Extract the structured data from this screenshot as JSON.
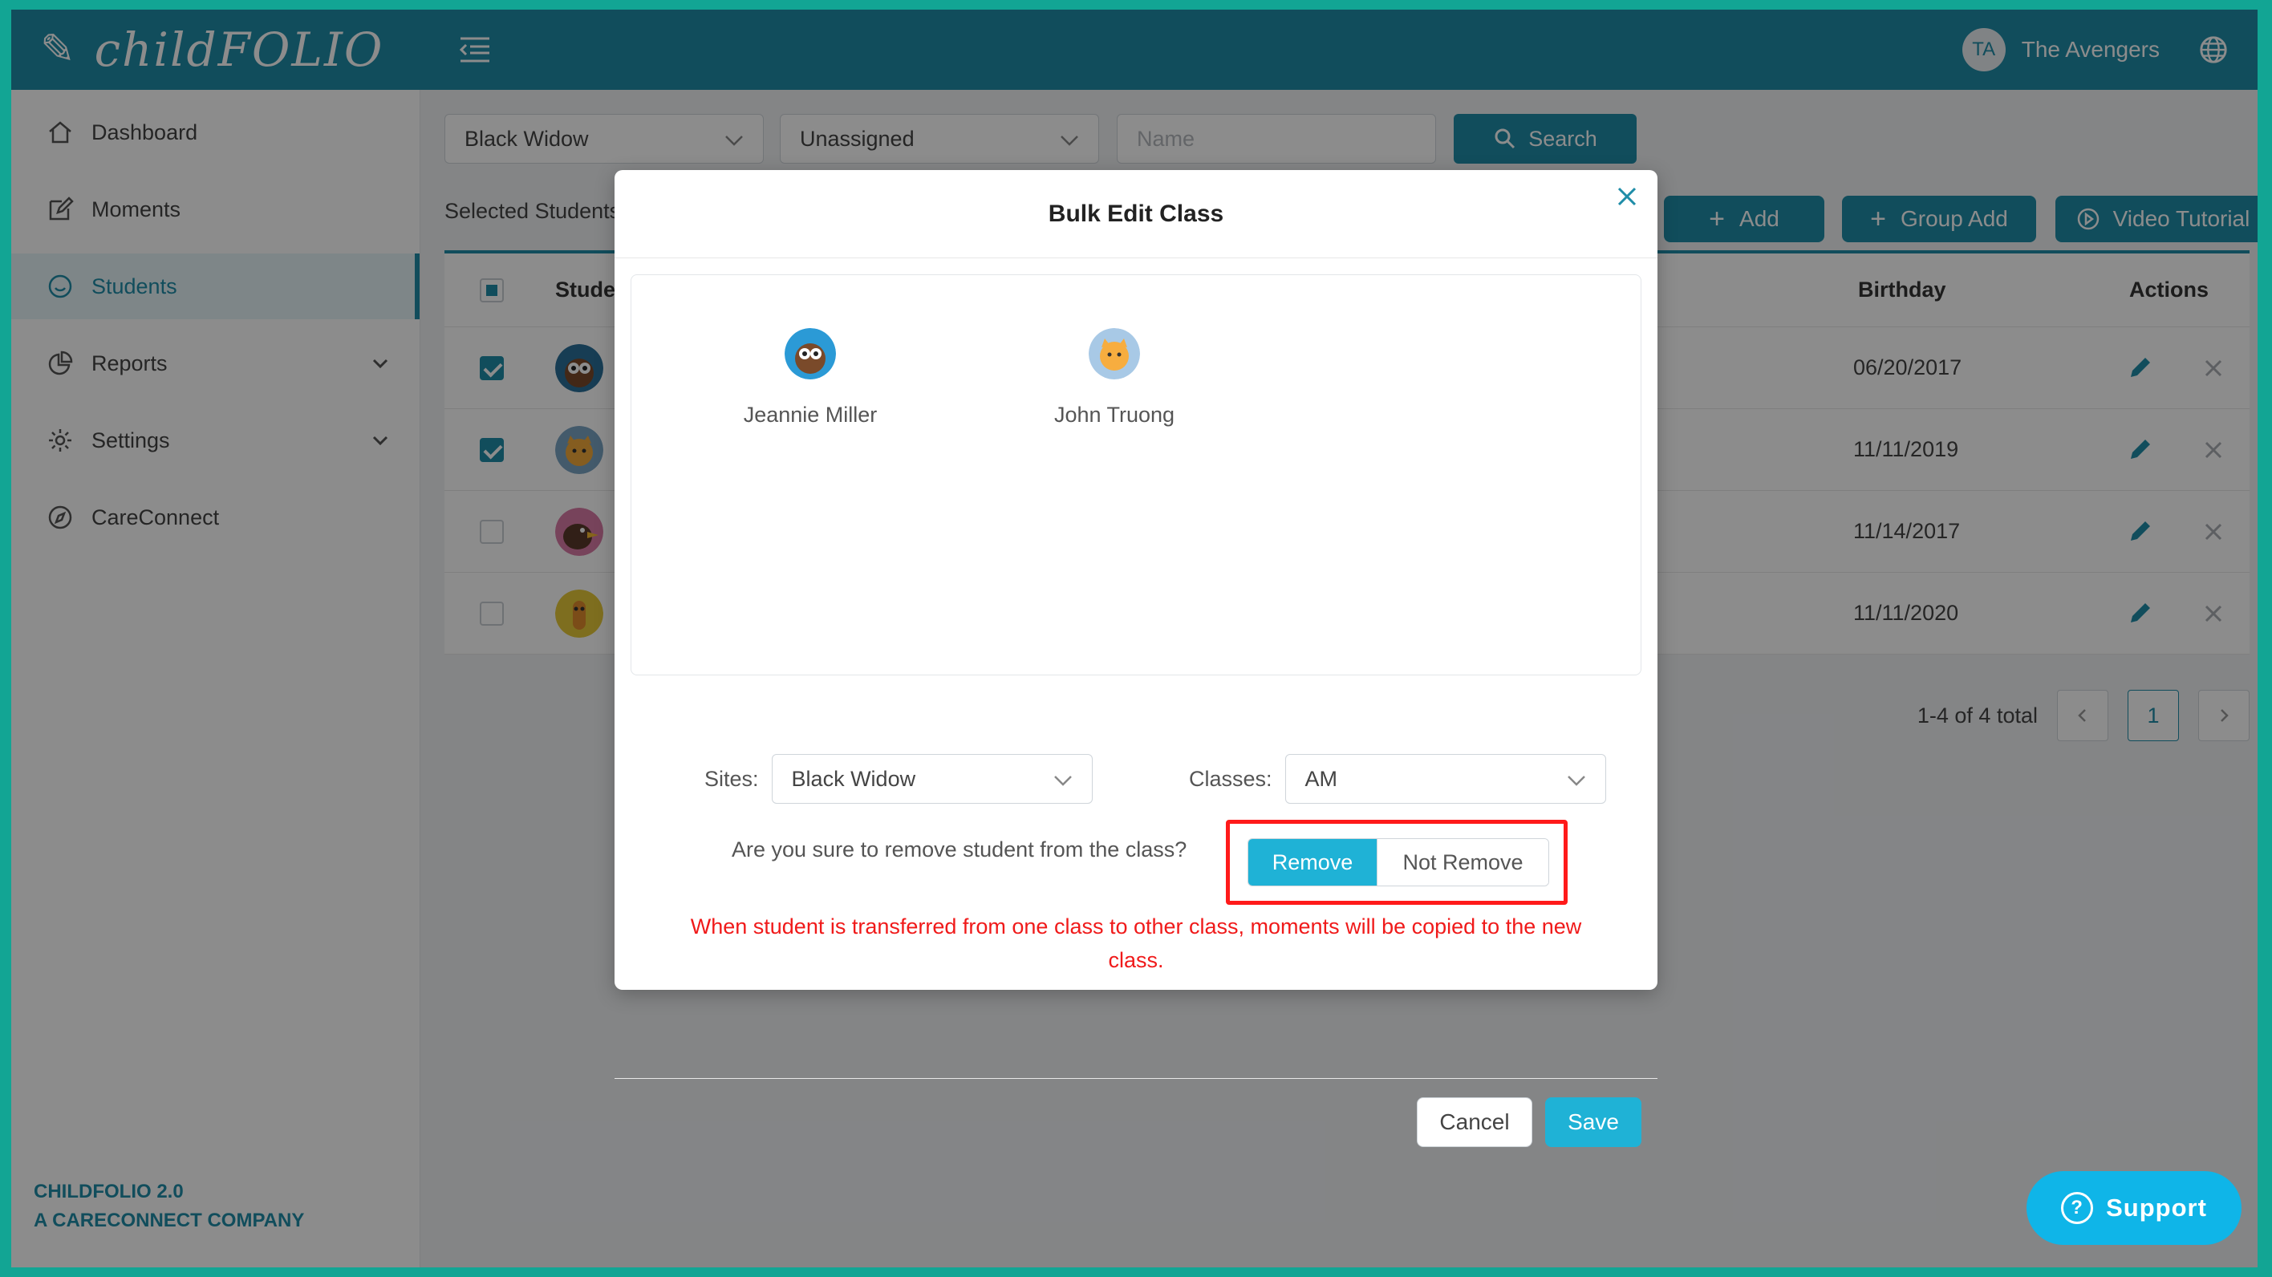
{
  "app": {
    "logo_text": "childFOLIO",
    "user_initials": "TA",
    "user_name": "The Avengers"
  },
  "sidebar": {
    "items": [
      {
        "label": "Dashboard",
        "icon": "home-icon"
      },
      {
        "label": "Moments",
        "icon": "edit-icon"
      },
      {
        "label": "Students",
        "icon": "smile-icon",
        "active": true
      },
      {
        "label": "Reports",
        "icon": "pie-chart-icon",
        "expandable": true
      },
      {
        "label": "Settings",
        "icon": "gear-icon",
        "expandable": true
      },
      {
        "label": "CareConnect",
        "icon": "compass-icon"
      }
    ],
    "footer_line1": "CHILDFOLIO 2.0",
    "footer_line2": "A CARECONNECT COMPANY"
  },
  "filters": {
    "site_value": "Black Widow",
    "status_value": "Unassigned",
    "name_placeholder": "Name",
    "search_label": "Search"
  },
  "toolbar": {
    "selected_label": "Selected Students",
    "add_label": "Add",
    "group_add_label": "Group Add",
    "video_label": "Video Tutorial"
  },
  "table": {
    "headers": {
      "student": "Student",
      "birthday": "Birthday",
      "actions": "Actions"
    },
    "rows": [
      {
        "checked": true,
        "birthday": "06/20/2017",
        "avatar": "owl"
      },
      {
        "checked": true,
        "birthday": "11/11/2019",
        "avatar": "cat"
      },
      {
        "checked": false,
        "birthday": "11/14/2017",
        "avatar": "bird"
      },
      {
        "checked": false,
        "birthday": "11/11/2020",
        "avatar": "giraffe"
      }
    ],
    "pagination": {
      "summary": "1-4 of 4 total",
      "current": "1"
    }
  },
  "modal": {
    "title": "Bulk Edit Class",
    "students": [
      {
        "name": "Jeannie Miller",
        "avatar": "owl"
      },
      {
        "name": "John Truong",
        "avatar": "cat"
      }
    ],
    "sites_label": "Sites",
    "sites_value": "Black Widow",
    "classes_label": "Classes",
    "classes_value": "AM",
    "remove_prompt": "Are you sure to remove student from the class?",
    "remove_label": "Remove",
    "not_remove_label": "Not Remove",
    "warning": "When student is transferred from one class to other class, moments will be copied to the new class.",
    "cancel_label": "Cancel",
    "save_label": "Save"
  },
  "support_label": "Support",
  "colors": {
    "brand": "#1f8da8",
    "accent": "#1fb2d6",
    "warning": "#f01a1a",
    "highlight_box": "#ff1a1a",
    "support": "#0fb5e8"
  }
}
